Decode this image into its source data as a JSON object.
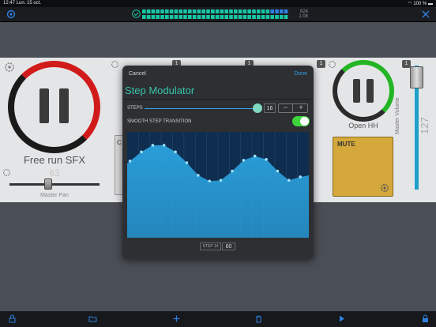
{
  "status_bar": {
    "time_date": "12:47   Lun. 15 oct.",
    "battery": "100 %"
  },
  "top_bar": {
    "count_top": "624",
    "count_bottom": "1:08",
    "accent": "#18c7a4"
  },
  "pads": {
    "sfx": {
      "title": "Free run SFX",
      "pan_value": "63",
      "pan_label": "Master Pan",
      "ring_color": "#d11b1b"
    },
    "hh": {
      "title": "Open HH",
      "ring_color": "#23b523"
    },
    "card_c_label": "C",
    "badges": [
      "1",
      "1",
      "1",
      "1"
    ],
    "mute_label": "MUTE"
  },
  "volume": {
    "label": "Master Volume",
    "value": "127"
  },
  "dialog": {
    "cancel": "Cancel",
    "done": "Done",
    "title": "Step Modulator",
    "steps_label": "STEPS",
    "steps_value": "16",
    "smooth_label": "SMOOTH STEP TRANSITION",
    "smooth_enabled": true,
    "step_indicator_label": "STEP 14",
    "step_indicator_value": "60"
  },
  "chart_data": {
    "type": "area",
    "steps": 16,
    "ylim": [
      0,
      127
    ],
    "values": [
      92,
      103,
      111,
      111,
      103,
      90,
      75,
      68,
      69,
      80,
      93,
      98,
      94,
      80,
      69,
      73
    ],
    "fill_color": "#2ba3df",
    "background": "#0f2d4f"
  },
  "icons": [
    "gear-icon",
    "check-circle-icon",
    "close-icon",
    "lock-icon",
    "folder-icon",
    "plus-icon",
    "trash-icon",
    "play-icon",
    "wifi-icon",
    "battery-icon"
  ]
}
